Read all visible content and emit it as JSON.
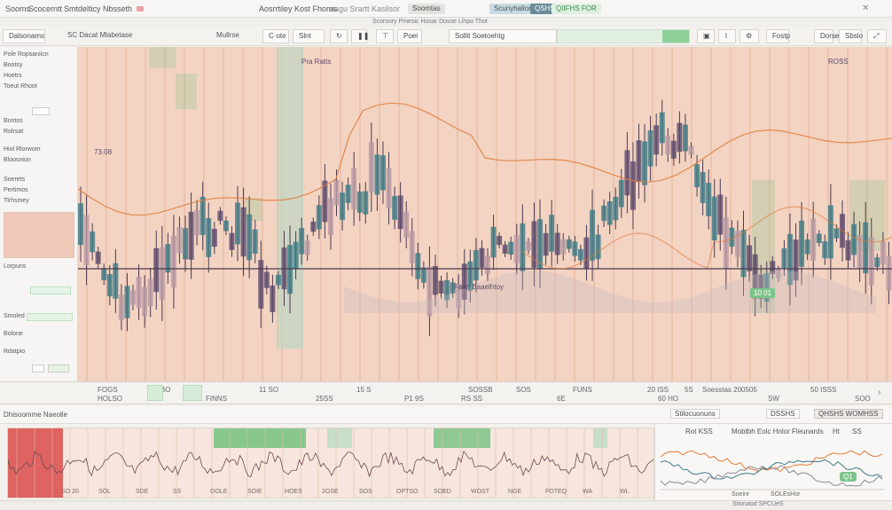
{
  "titlebar": {
    "left_a": "Sooms",
    "left_b": "Scocerntt",
    "left_c": "Smtdelticy Nbsseth",
    "center": "Aosrrtiley Kost Fhoms",
    "center_b": "aagu Srartt  Kasilsor",
    "pill_a": "Soomtas",
    "pill_b": "Scunyhalion",
    "pill_c": "QSHS",
    "right": "QIIFHS FOR",
    "sub": "Scorsory Pmesic Hosar Dosse Lihpo Thot"
  },
  "toolbar": {
    "left_box": "Dalsonams",
    "title": "SC Dacat Mlabetase",
    "item_a": "Mullrse",
    "item_b": "C·ote",
    "item_c": "Slnt",
    "item_d": "Poei",
    "item_e": "Sollit Soetoehtg",
    "item_f": "Fostp",
    "item_g": "Dorse",
    "item_h": "Sbslo"
  },
  "sidebar": {
    "items": [
      "Pole Ropsaniicn",
      "Bootsy",
      "Hoetrs",
      "Toeut Rhoot",
      "Bontos",
      "Rolrsat",
      "Hiol Rlorwom",
      "Bloosnion",
      "Soerets",
      "Pertimos",
      "Tlrhsmey",
      "Lorpuns",
      "Smoled",
      "Bolone",
      "Rdatpio"
    ]
  },
  "chart": {
    "annotation_top": "Pra Ratts",
    "annotation_mid": "Faan Baaelhtoy",
    "annotation_num": "73.08",
    "annotation_right": "ROSS",
    "badge": "10 01"
  },
  "axisbar": {
    "labels": [
      "FOGS",
      "HOLSO",
      "PWBO",
      "FINNS",
      "11 SO",
      "25SS",
      "15 S",
      "P1 9S",
      "RS SS",
      "SOSSB",
      "SOS",
      "6E",
      "FUNS",
      "20 ISS",
      "60 HO",
      "5S",
      "Soesstas 200505",
      "SW",
      "50 ISSS",
      "SOO"
    ]
  },
  "statusbar": {
    "left": "Dhisoomme Naeolle",
    "right_a": "Stilocuonuns",
    "right_b": "DSSHS",
    "right_c": "QHSHS WOMHSS"
  },
  "lower": {
    "ticks": [
      "SO 20",
      "SOL",
      "SDE",
      "SS",
      "OOLE",
      "SOIE",
      "HOES",
      "2OSE",
      "SOS",
      "OPTSO",
      "SOED",
      "WOST",
      "NGE",
      "FOTEQ",
      "WA",
      "WL"
    ]
  },
  "mini": {
    "title": "Rot KSS",
    "title_b": "Mobtbh Eolc Hnlor Fleunards",
    "corner": "Ht",
    "corner_b": "SS",
    "tag": "Q1",
    "foot_a": "Soeinr",
    "foot_b": "SOLEsHor"
  },
  "bottom": {
    "text": "Stionaod  SPCUeS"
  },
  "colors": {
    "chart_bg": "#f3d3c2",
    "green": "#6bbf7a",
    "teal": "#3c7a86",
    "purple": "#5b4a6b",
    "orange": "#e07b39",
    "red": "#d94b4b"
  }
}
